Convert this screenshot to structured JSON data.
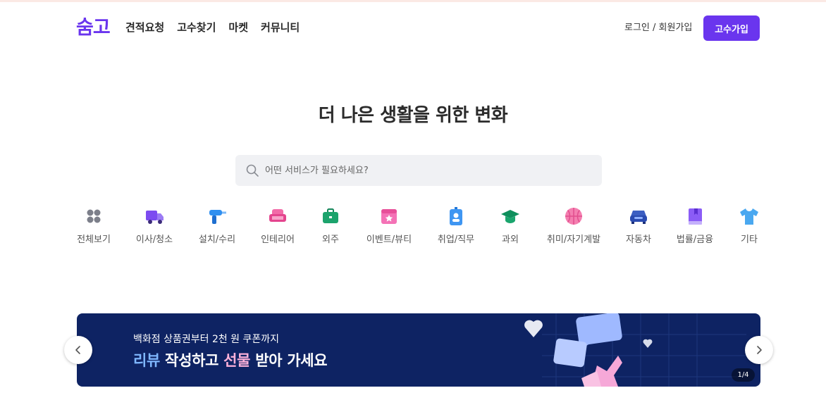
{
  "header": {
    "logo": "숨고",
    "nav": [
      "견적요청",
      "고수찾기",
      "마켓",
      "커뮤니티"
    ],
    "login_label": "로그인 / 회원가입",
    "join_label": "고수가입"
  },
  "hero": {
    "title": "더 나은 생활을 위한 변화",
    "search_placeholder": "어떤 서비스가 필요하세요?"
  },
  "categories": [
    {
      "label": "전체보기",
      "icon": "grid-icon"
    },
    {
      "label": "이사/청소",
      "icon": "truck-icon"
    },
    {
      "label": "설치/수리",
      "icon": "drill-icon"
    },
    {
      "label": "인테리어",
      "icon": "sofa-icon"
    },
    {
      "label": "외주",
      "icon": "briefcase-icon"
    },
    {
      "label": "이벤트/뷰티",
      "icon": "calendar-icon"
    },
    {
      "label": "취업/직무",
      "icon": "id-badge-icon"
    },
    {
      "label": "과외",
      "icon": "graduation-cap-icon"
    },
    {
      "label": "취미/자기계발",
      "icon": "basketball-icon"
    },
    {
      "label": "자동차",
      "icon": "car-icon"
    },
    {
      "label": "법률/금융",
      "icon": "book-icon"
    },
    {
      "label": "기타",
      "icon": "tshirt-icon"
    }
  ],
  "banner": {
    "subtitle": "백화점 상품권부터 2천 원 쿠폰까지",
    "main_part1": "리뷰",
    "main_part2": " 작성하고 ",
    "main_part3": "선물",
    "main_part4": " 받아 가세요",
    "counter": "1/4"
  },
  "colors": {
    "brand": "#6a35ee",
    "banner_bg": "#0e2363",
    "highlight_blue": "#7fb7ff",
    "highlight_pink": "#ffb2da"
  }
}
